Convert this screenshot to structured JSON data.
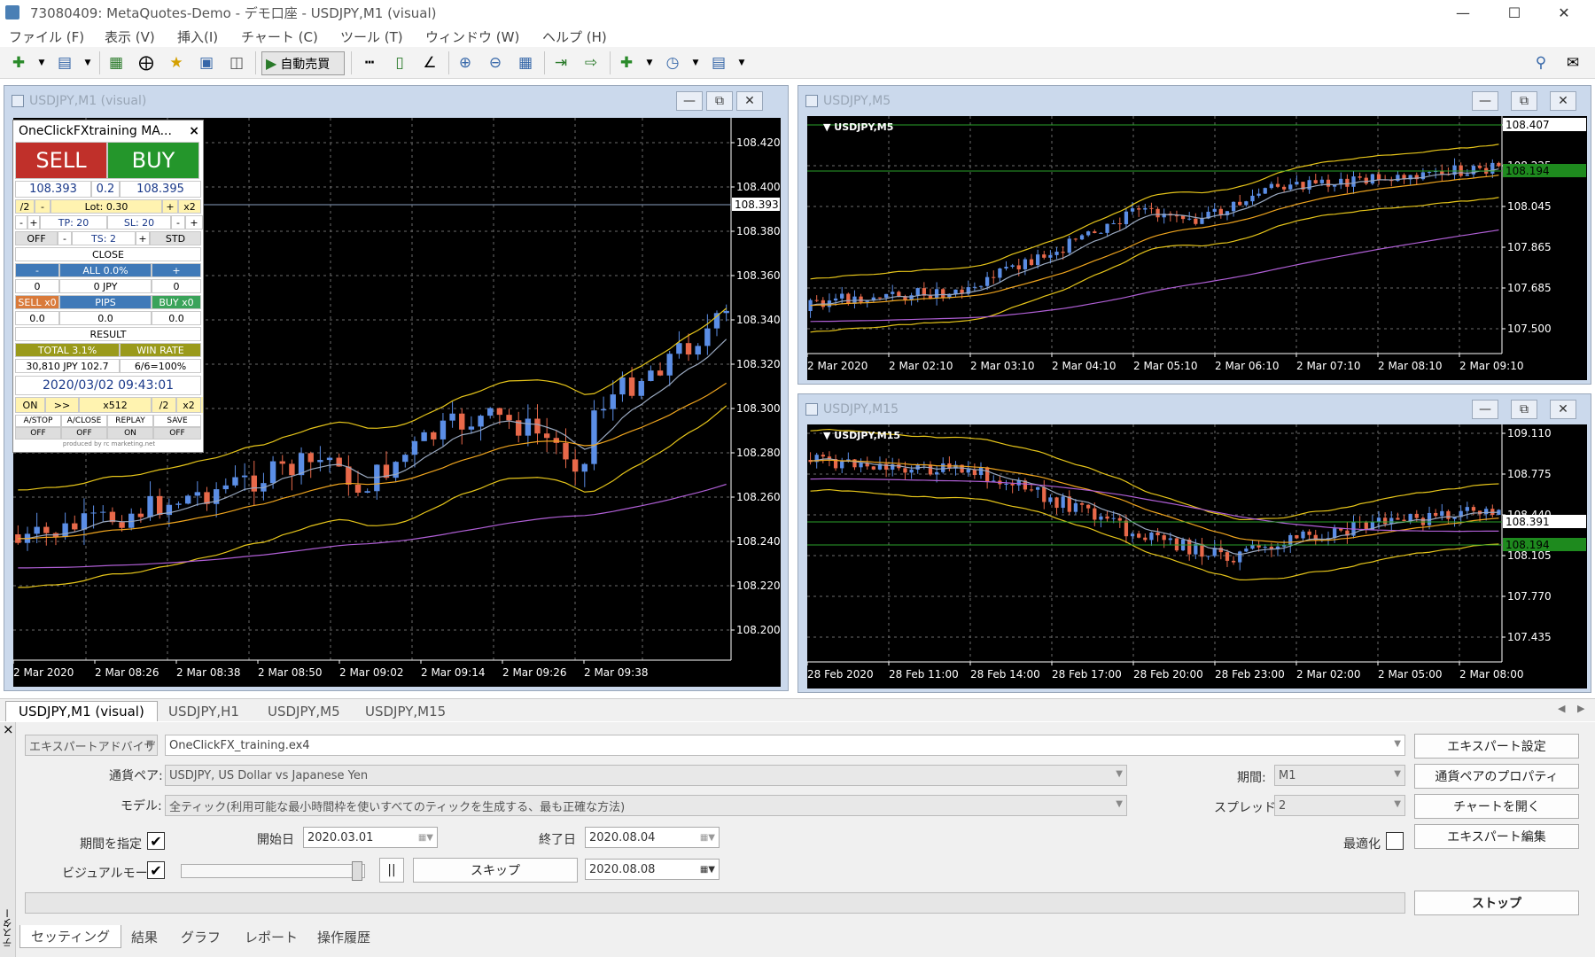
{
  "app": {
    "title": "73080409: MetaQuotes-Demo - デモ口座 - USDJPY,M1 (visual)"
  },
  "menu": [
    "ファイル (F)",
    "表示 (V)",
    "挿入(I)",
    "チャート (C)",
    "ツール (T)",
    "ウィンドウ (W)",
    "ヘルプ (H)"
  ],
  "toolbar": {
    "autotrade_label": "自動売買"
  },
  "charts": {
    "m1": {
      "title": "USDJPY,M1 (visual)",
      "prices": [
        "108.420",
        "108.400",
        "108.380",
        "108.360",
        "108.340",
        "108.320",
        "108.300",
        "108.280",
        "108.260",
        "108.240",
        "108.220",
        "108.200"
      ],
      "badge": "108.393",
      "times": [
        "2 Mar 2020",
        "2 Mar 08:26",
        "2 Mar 08:38",
        "2 Mar 08:50",
        "2 Mar 09:02",
        "2 Mar 09:14",
        "2 Mar 09:26",
        "2 Mar 09:38"
      ]
    },
    "m5": {
      "title": "USDJPY,M5",
      "symbol": "USDJPY,M5",
      "prices": [
        "108.407",
        "108.225",
        "108.045",
        "107.865",
        "107.685",
        "107.500"
      ],
      "badge1": "108.407",
      "badge2": "108.194",
      "times": [
        "2 Mar 2020",
        "2 Mar 02:10",
        "2 Mar 03:10",
        "2 Mar 04:10",
        "2 Mar 05:10",
        "2 Mar 06:10",
        "2 Mar 07:10",
        "2 Mar 08:10",
        "2 Mar 09:10"
      ]
    },
    "m15": {
      "title": "USDJPY,M15",
      "symbol": "USDJPY,M15",
      "prices": [
        "109.110",
        "108.775",
        "108.440",
        "108.105",
        "107.770",
        "107.435"
      ],
      "badge1": "108.391",
      "badge2": "108.194",
      "times": [
        "28 Feb 2020",
        "28 Feb 11:00",
        "28 Feb 14:00",
        "28 Feb 17:00",
        "28 Feb 20:00",
        "28 Feb 23:00",
        "2 Mar 02:00",
        "2 Mar 05:00",
        "2 Mar 08:00"
      ]
    }
  },
  "panel": {
    "title": "OneClickFXtraining MA...",
    "sell": "SELL",
    "buy": "BUY",
    "bid": "108.393",
    "spread": "0.2",
    "ask": "108.395",
    "half": "/2",
    "minus": "-",
    "plus": "+",
    "lot": "Lot: 0.30",
    "x2": "x2",
    "tp": "TP: 20",
    "sl": "SL: 20",
    "off": "OFF",
    "ts": "TS: 2",
    "std": "STD",
    "close": "CLOSE",
    "all": "ALL 0.0%",
    "zero": "0",
    "jpy": "0 JPY",
    "sellx": "SELL x0",
    "pips": "PIPS",
    "buyx": "BUY x0",
    "dz": "0.0",
    "result": "RESULT",
    "total": "TOTAL 3.1%",
    "winrate": "WIN RATE",
    "profit": "30,810 JPY 102.7",
    "wins": "6/6=100%",
    "datetime": "2020/03/02  09:43:01",
    "on": "ON",
    "ff": ">>",
    "speed": "x512",
    "astop": "A/STOP",
    "aclose": "A/CLOSE",
    "replay": "REPLAY",
    "save": "SAVE",
    "offv": "OFF",
    "onv": "ON",
    "credit": "produced by rc marketing.net"
  },
  "charttabs": [
    "USDJPY,M1 (visual)",
    "USDJPY,H1",
    "USDJPY,M5",
    "USDJPY,M15"
  ],
  "tester": {
    "expert_type": "エキスパートアドバイザ",
    "expert": "OneClickFX_training.ex4",
    "pair_label": "通貨ペア:",
    "pair": "USDJPY, US Dollar vs Japanese Yen",
    "model_label": "モデル:",
    "model": "全ティック(利用可能な最小時間枠を使いすべてのティックを生成する、最も正確な方法)",
    "period_spec": "期間を指定",
    "start_label": "開始日",
    "start": "2020.03.01",
    "end_label": "終了日",
    "end": "2020.08.04",
    "visual_label": "ビジュアルモード",
    "pause": "||",
    "skip": "スキップ",
    "skipdate": "2020.08.08",
    "period_label": "期間:",
    "period": "M1",
    "spread_label": "スプレッド:",
    "spread": "2",
    "optim_label": "最適化",
    "btn_expert_settings": "エキスパート設定",
    "btn_pair_props": "通貨ペアのプロパティ",
    "btn_open_chart": "チャートを開く",
    "btn_expert_edit": "エキスパート編集",
    "btn_stop": "ストップ",
    "side": "テスター",
    "close": "×",
    "tabs": [
      "セッティング",
      "結果",
      "グラフ",
      "レポート",
      "操作履歴"
    ]
  },
  "colors": {
    "bull": "#5b8ee6",
    "bear": "#e8694a",
    "band": "#e6c51a",
    "ma": "#f0a51e",
    "slow": "#b05fd6",
    "sell": "#c0302a",
    "buy": "#24962b"
  }
}
